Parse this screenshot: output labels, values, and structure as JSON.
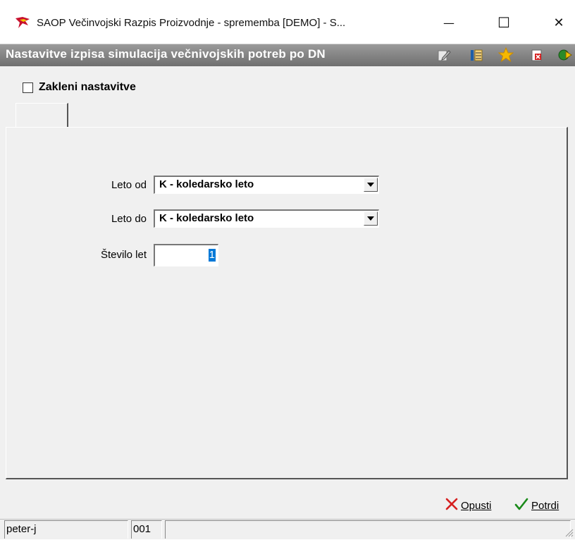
{
  "window": {
    "title": "SAOP  Večinvojski Razpis Proizvodnje - sprememba [DEMO] - S...",
    "minimize_glyph": "—",
    "maximize_glyph": "☐",
    "close_glyph": "✕"
  },
  "header": {
    "title": "Nastavitve izpisa simulacija večnivojskih potreb po DN",
    "toolbar_icons": [
      "edit-icon",
      "columns-icon",
      "star-icon",
      "delete-icon",
      "exit-icon"
    ]
  },
  "lock_settings": {
    "label": "Zakleni nastavitve",
    "checked": false
  },
  "tabs": [
    {
      "label": ""
    }
  ],
  "form": {
    "year_from_label": "Leto od",
    "year_from_value": "K - koledarsko leto",
    "year_to_label": "Leto do",
    "year_to_value": "K - koledarsko leto",
    "years_count_label": "Število let",
    "years_count_value": "1"
  },
  "actions": {
    "cancel_label": "Opusti",
    "confirm_label": "Potrdi"
  },
  "status": {
    "user": "peter-j",
    "code": "001",
    "info": ""
  },
  "colors": {
    "header_band": "#808080",
    "selection": "#0078d7",
    "cancel_icon": "#d62020",
    "confirm_icon": "#1a8a1a",
    "star": "#f5b800"
  }
}
